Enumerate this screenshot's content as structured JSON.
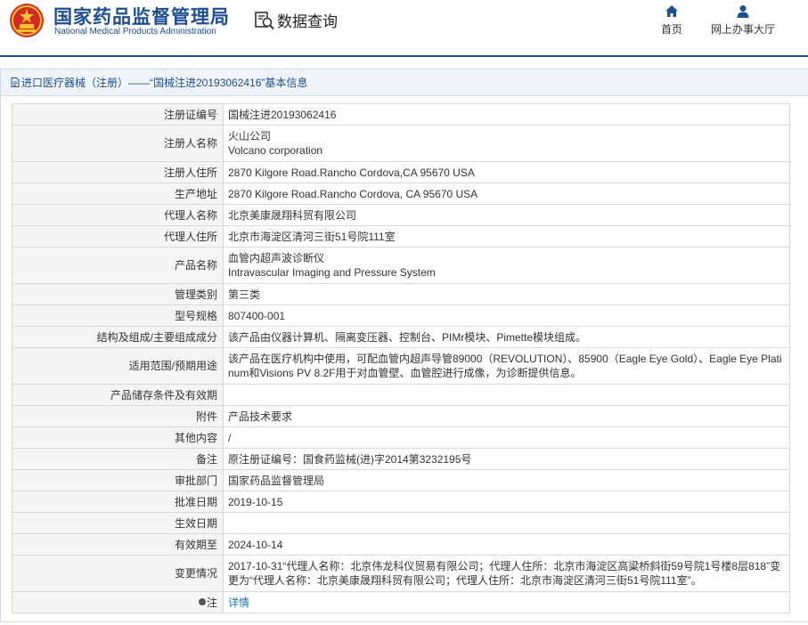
{
  "header": {
    "brand_cn": "国家药品监督管理局",
    "brand_en": "National Medical Products Administration",
    "search_label": "数据查询",
    "nav": [
      {
        "label": "首页",
        "icon": "home-icon"
      },
      {
        "label": "网上办事大厅",
        "icon": "person-icon"
      }
    ],
    "accent_color": "#1c4f96"
  },
  "panel": {
    "title": "进口医疗器械（注册）——“国械注进20193062416”基本信息"
  },
  "rows": [
    {
      "key": "注册证编号",
      "value": "国械注进20193062416"
    },
    {
      "key": "注册人名称",
      "value": "火山公司",
      "value2": "Volcano corporation"
    },
    {
      "key": "注册人住所",
      "value": "2870 Kilgore Road.Rancho Cordova,CA 95670 USA"
    },
    {
      "key": "生产地址",
      "value": "2870 Kilgore Road.Rancho Cordova, CA 95670 USA"
    },
    {
      "key": "代理人名称",
      "value": "北京美康晟翔科贸有限公司"
    },
    {
      "key": "代理人住所",
      "value": "北京市海淀区清河三街51号院111室"
    },
    {
      "key": "产品名称",
      "value": "血管内超声波诊断仪",
      "value2": "Intravascular Imaging and Pressure System"
    },
    {
      "key": "管理类别",
      "value": "第三类"
    },
    {
      "key": "型号规格",
      "value": "807400-001"
    },
    {
      "key": "结构及组成/主要组成成分",
      "value": "该产品由仪器计算机、隔离变压器、控制台、PIMr模块、Pimette模块组成。"
    },
    {
      "key": "适用范围/预期用途",
      "value": "该产品在医疗机构中使用，可配血管内超声导管89000（REVOLUTION）、85900（Eagle Eye Gold）、Eagle Eye Platinum和Visions PV 8.2F用于对血管壁、血管腔进行成像，为诊断提供信息。"
    },
    {
      "key": "产品储存条件及有效期",
      "value": ""
    },
    {
      "key": "附件",
      "value": "产品技术要求"
    },
    {
      "key": "其他内容",
      "value": "/"
    },
    {
      "key": "备注",
      "value": "原注册证编号：国食药监械(进)字2014第3232195号"
    },
    {
      "key": "审批部门",
      "value": "国家药品监督管理局"
    },
    {
      "key": "批准日期",
      "value": "2019-10-15"
    },
    {
      "key": "生效日期",
      "value": ""
    },
    {
      "key": "有效期至",
      "value": "2024-10-14"
    },
    {
      "key": "变更情况",
      "value": "2017-10-31“代理人名称：北京伟龙科仪贸易有限公司；代理人住所：北京市海淀区高粱桥斜街59号院1号楼8层818”变更为“代理人名称：北京美康晟翔科贸有限公司；代理人住所：北京市海淀区清河三街51号院111室”。"
    },
    {
      "key": "注",
      "value": "详情"
    }
  ]
}
